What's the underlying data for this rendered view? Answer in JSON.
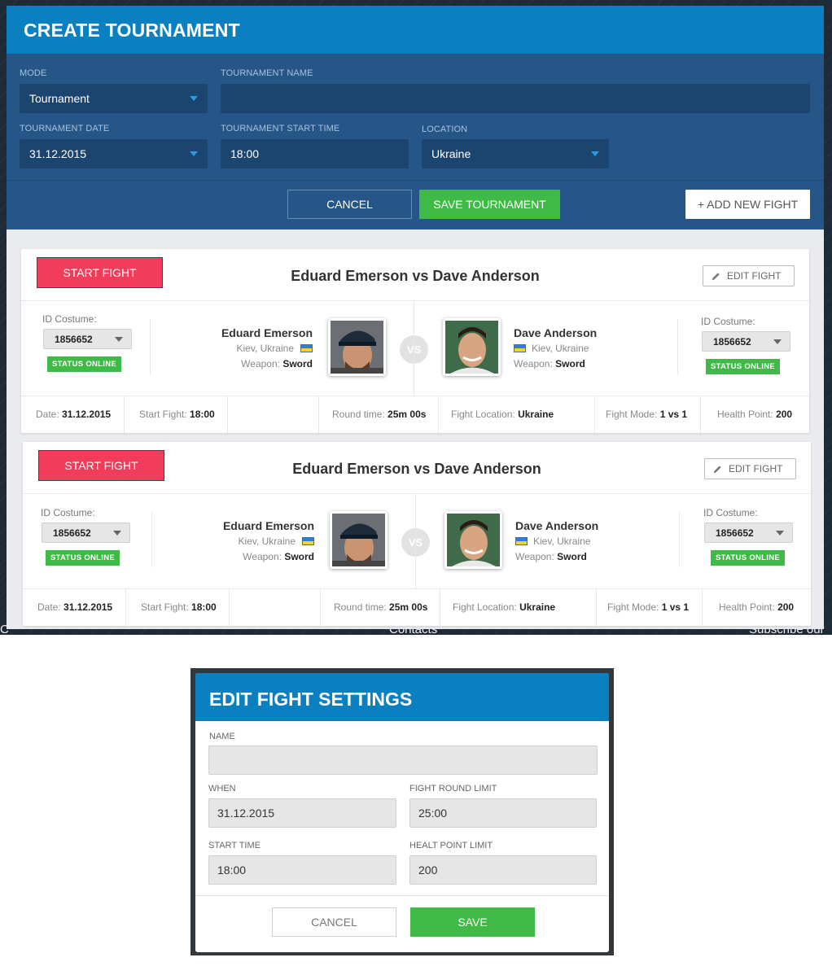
{
  "background": {
    "contacts_text": "Contacts",
    "subscribe_text": "Subscribe our",
    "left_fragment": "C"
  },
  "create_tournament": {
    "title": "CREATE TOURNAMENT",
    "fields": {
      "mode": {
        "label": "MODE",
        "value": "Tournament"
      },
      "name": {
        "label": "TOURNAMENT NAME",
        "value": ""
      },
      "date": {
        "label": "TOURNAMENT DATE",
        "value": "31.12.2015"
      },
      "start_time": {
        "label": "TOURNAMENT START TIME",
        "value": "18:00"
      },
      "location": {
        "label": "LOCATION",
        "value": "Ukraine"
      }
    },
    "buttons": {
      "cancel": "CANCEL",
      "save": "SAVE TOURNAMENT",
      "add_fight": "+ ADD NEW FIGHT"
    },
    "colors": {
      "header": "#0a80c1",
      "form_bg": "#255687",
      "input_bg": "#1b456f",
      "save_green": "#3fba47",
      "start_red": "#f23c5c"
    }
  },
  "fights": [
    {
      "start_button": "START FIGHT",
      "title": "Eduard Emerson vs Dave Anderson",
      "edit_button": "EDIT FIGHT",
      "left": {
        "id_label": "ID Costume:",
        "id_value": "1856652",
        "status": "STATUS ONLINE",
        "name": "Eduard Emerson",
        "location": "Kiev, Ukraine",
        "weapon_label": "Weapon:",
        "weapon": "Sword",
        "avatar_icon": "fighter-cap-portrait"
      },
      "vs": "VS",
      "right": {
        "id_label": "ID Costume:",
        "id_value": "1856652",
        "status": "STATUS ONLINE",
        "name": "Dave Anderson",
        "location": "Kiev, Ukraine",
        "weapon_label": "Weapon:",
        "weapon": "Sword",
        "avatar_icon": "fighter-portrait"
      },
      "footer": {
        "date_label": "Date:",
        "date": "31.12.2015",
        "start_label": "Start Fight:",
        "start": "18:00",
        "round_label": "Round time:",
        "round": "25m 00s",
        "location_label": "Fight Location:",
        "location": "Ukraine",
        "mode_label": "Fight Mode:",
        "mode": "1 vs 1",
        "health_label": "Health Point:",
        "health": "200"
      }
    },
    {
      "start_button": "START FIGHT",
      "title": "Eduard Emerson vs Dave Anderson",
      "edit_button": "EDIT FIGHT",
      "left": {
        "id_label": "ID Costume:",
        "id_value": "1856652",
        "status": "STATUS ONLINE",
        "name": "Eduard Emerson",
        "location": "Kiev, Ukraine",
        "weapon_label": "Weapon:",
        "weapon": "Sword",
        "avatar_icon": "fighter-cap-portrait"
      },
      "vs": "VS",
      "right": {
        "id_label": "ID Costume:",
        "id_value": "1856652",
        "status": "STATUS ONLINE",
        "name": "Dave Anderson",
        "location": "Kiev, Ukraine",
        "weapon_label": "Weapon:",
        "weapon": "Sword",
        "avatar_icon": "fighter-portrait"
      },
      "footer": {
        "date_label": "Date:",
        "date": "31.12.2015",
        "start_label": "Start Fight:",
        "start": "18:00",
        "round_label": "Round time:",
        "round": "25m 00s",
        "location_label": "Fight Location:",
        "location": "Ukraine",
        "mode_label": "Fight Mode:",
        "mode": "1 vs 1",
        "health_label": "Health Point:",
        "health": "200"
      }
    }
  ],
  "edit_fight": {
    "title": "EDIT FIGHT SETTINGS",
    "fields": {
      "name": {
        "label": "NAME",
        "value": ""
      },
      "when": {
        "label": "WHEN",
        "value": "31.12.2015"
      },
      "round_limit": {
        "label": "FIGHT ROUND LIMIT",
        "value": "25:00"
      },
      "start_time": {
        "label": "START TIME",
        "value": "18:00"
      },
      "health_limit": {
        "label": "HEALT POINT LIMIT",
        "value": "200"
      }
    },
    "buttons": {
      "cancel": "CANCEL",
      "save": "SAVE"
    }
  }
}
